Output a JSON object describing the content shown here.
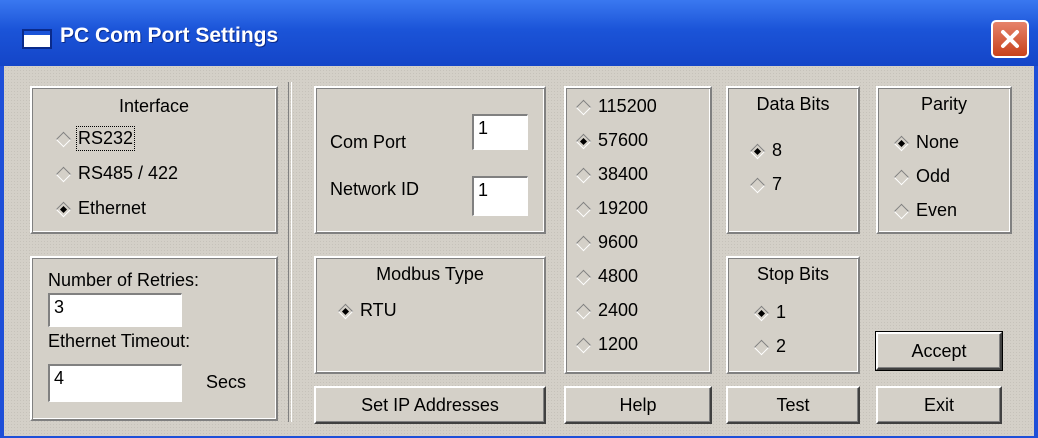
{
  "window": {
    "title": "PC Com Port Settings"
  },
  "interface": {
    "title": "Interface",
    "options": [
      {
        "label": "RS232",
        "selected": false
      },
      {
        "label": "RS485 / 422",
        "selected": false
      },
      {
        "label": "Ethernet",
        "selected": true
      }
    ]
  },
  "retries": {
    "retries_label": "Number of Retries:",
    "retries_value": "3",
    "timeout_label": "Ethernet Timeout:",
    "timeout_value": "4",
    "timeout_unit": "Secs"
  },
  "port": {
    "com_port_label": "Com Port",
    "com_port_value": "1",
    "network_id_label": "Network ID",
    "network_id_value": "1"
  },
  "modbus": {
    "title": "Modbus Type",
    "options": [
      {
        "label": "RTU",
        "selected": true
      }
    ]
  },
  "baud": {
    "options": [
      {
        "label": "115200",
        "selected": false
      },
      {
        "label": "57600",
        "selected": true
      },
      {
        "label": "38400",
        "selected": false
      },
      {
        "label": "19200",
        "selected": false
      },
      {
        "label": "9600",
        "selected": false
      },
      {
        "label": "4800",
        "selected": false
      },
      {
        "label": "2400",
        "selected": false
      },
      {
        "label": "1200",
        "selected": false
      }
    ]
  },
  "data_bits": {
    "title": "Data Bits",
    "options": [
      {
        "label": "8",
        "selected": true
      },
      {
        "label": "7",
        "selected": false
      }
    ]
  },
  "stop_bits": {
    "title": "Stop Bits",
    "options": [
      {
        "label": "1",
        "selected": true
      },
      {
        "label": "2",
        "selected": false
      }
    ]
  },
  "parity": {
    "title": "Parity",
    "options": [
      {
        "label": "None",
        "selected": true
      },
      {
        "label": "Odd",
        "selected": false
      },
      {
        "label": "Even",
        "selected": false
      }
    ]
  },
  "buttons": {
    "set_ip": "Set IP Addresses",
    "help": "Help",
    "test": "Test",
    "accept": "Accept",
    "exit": "Exit"
  }
}
